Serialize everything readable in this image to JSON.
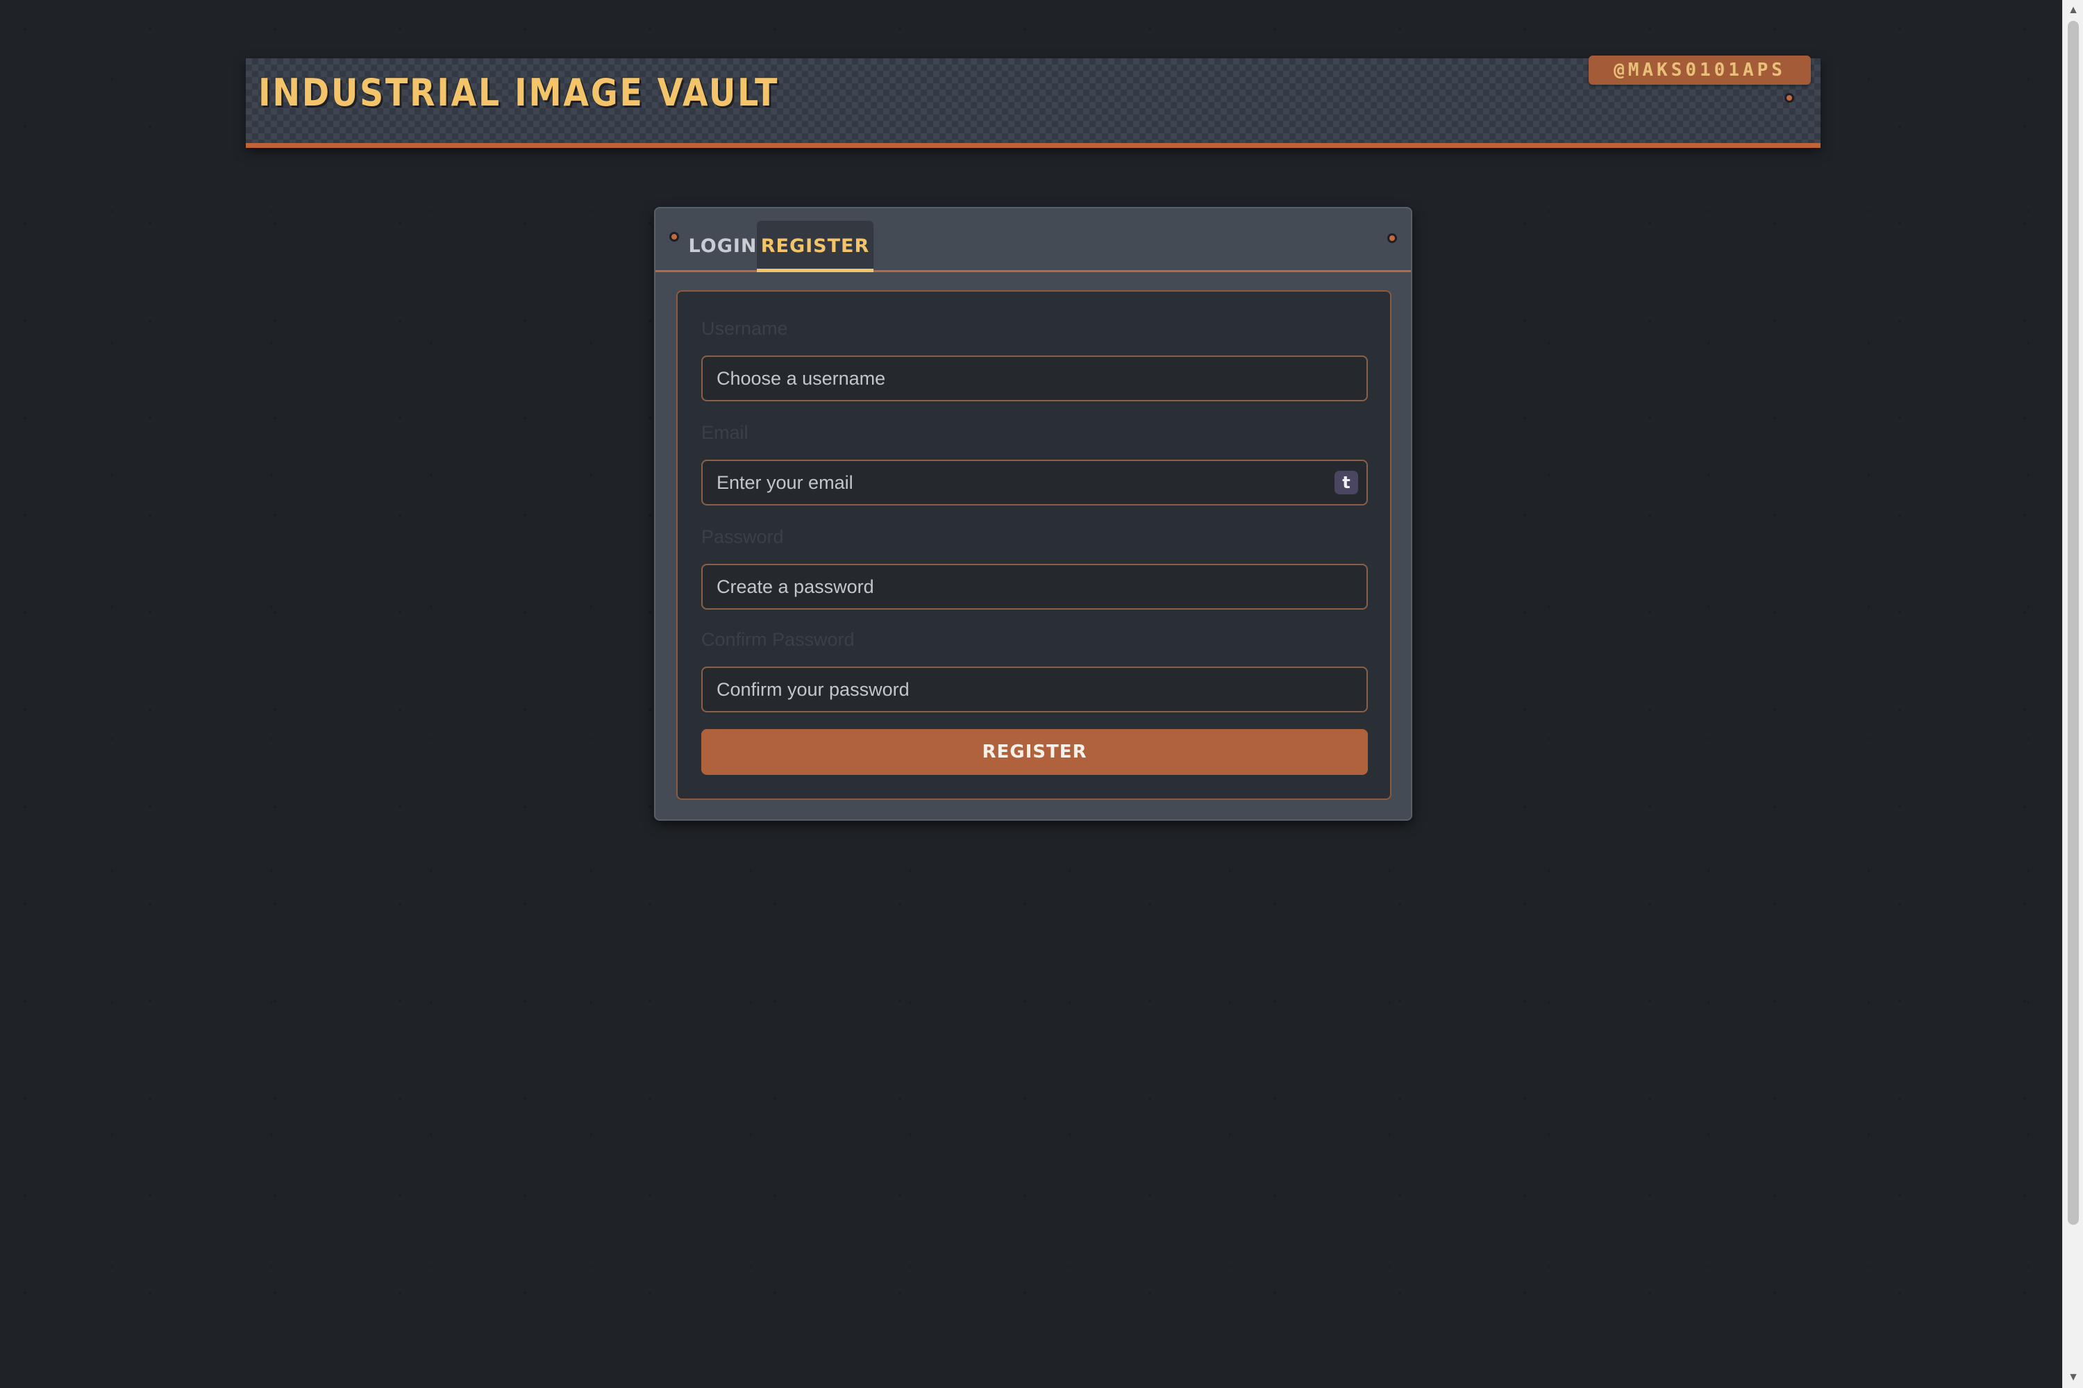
{
  "header": {
    "title": "INDUSTRIAL IMAGE VAULT",
    "user_handle": "@MAKS0101APS"
  },
  "auth": {
    "tabs": [
      {
        "label": "LOGIN",
        "active": false
      },
      {
        "label": "REGISTER",
        "active": true
      }
    ],
    "form": {
      "username": {
        "label": "Username",
        "placeholder": "Choose a username",
        "value": ""
      },
      "email": {
        "label": "Email",
        "placeholder": "Enter your email",
        "value": ""
      },
      "password": {
        "label": "Password",
        "placeholder": "Create a password",
        "value": ""
      },
      "confirm_password": {
        "label": "Confirm Password",
        "placeholder": "Confirm your password",
        "value": ""
      },
      "submit_label": "REGISTER"
    },
    "password_manager_icon_glyph": "t"
  },
  "icons": {
    "password_manager": "password-manager-icon",
    "rivet": "rivet-icon"
  },
  "colors": {
    "accent": "#b0623c",
    "title": "#f3c46a",
    "background": "#1f2328",
    "card": "#454b55"
  }
}
